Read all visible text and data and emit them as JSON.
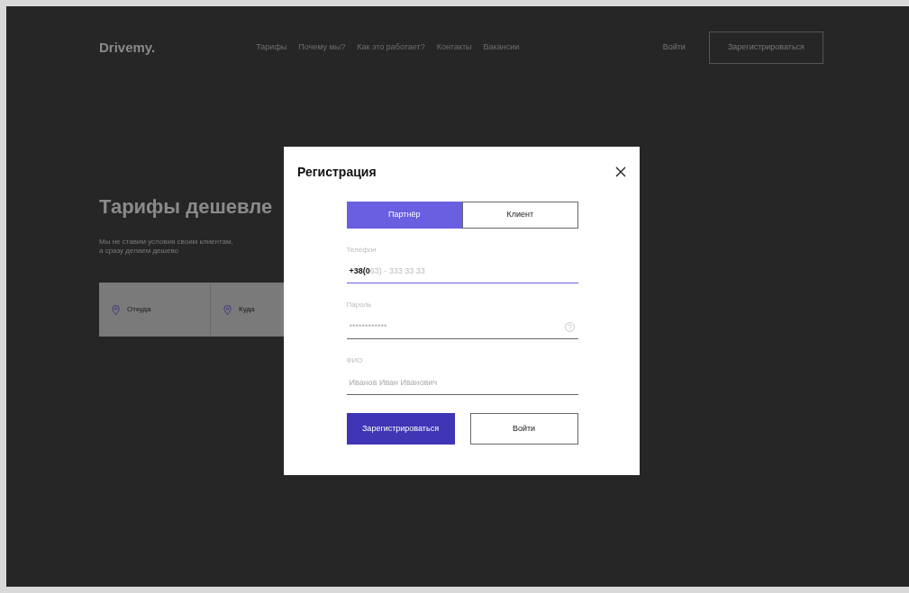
{
  "header": {
    "logo": "Drivemy.",
    "nav": [
      "Тарифы",
      "Почему мы?",
      "Как это работает?",
      "Контакты",
      "Вакансии"
    ],
    "login": "Войти",
    "register": "Зарегистрироваться"
  },
  "hero": {
    "title": "Тарифы дешевле",
    "subtitle": "Мы не ставим условия своим клиентам,\nа сразу делаем дешево",
    "route": [
      {
        "label": "Откуда"
      },
      {
        "label": "Куда"
      }
    ]
  },
  "modal": {
    "title": "Регистрация",
    "tabs": [
      {
        "label": "Партнёр",
        "selected": true
      },
      {
        "label": "Клиент",
        "selected": false
      }
    ],
    "fields": [
      {
        "label": "Телефон",
        "kind": "phone",
        "value": "+38(0",
        "mask": "63) - 333 33 33",
        "focused": true
      },
      {
        "label": "Пароль",
        "kind": "password",
        "placeholder": "************",
        "focused": false
      },
      {
        "label": "ФИО",
        "kind": "text",
        "placeholder": "Иванов Иван Иванович",
        "focused": false
      }
    ],
    "submit": "Зарегистрироваться",
    "login": "Войти"
  }
}
